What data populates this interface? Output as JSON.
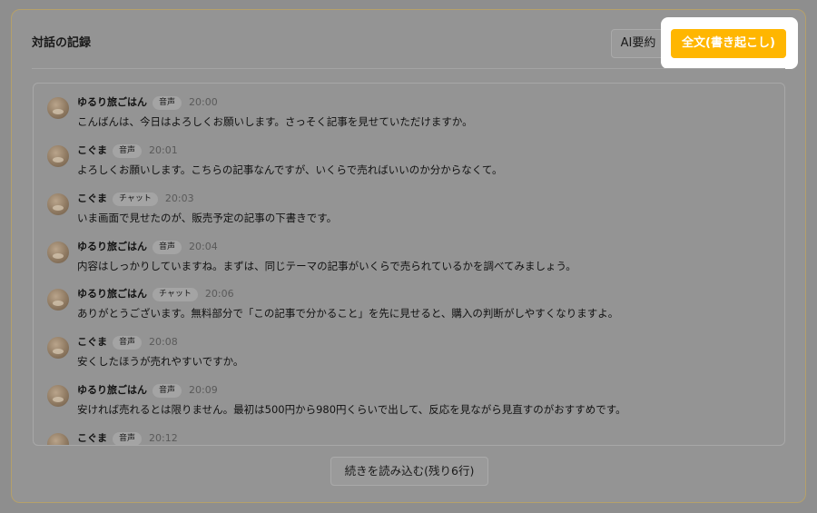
{
  "panel": {
    "title": "対話の記録",
    "summary_button": "AI要約",
    "full_text_button": "全文(書き起こし)",
    "load_more_button": "続きを読み込む(残り6行)"
  },
  "colors": {
    "accent": "#ffb600",
    "overlay": "#8e8e8e"
  },
  "messages": [
    {
      "name": "ゆるり旅ごはん",
      "channel": "音声",
      "time": "20:00",
      "text": "こんばんは、今日はよろしくお願いします。さっそく記事を見せていただけますか。"
    },
    {
      "name": "こぐま",
      "channel": "音声",
      "time": "20:01",
      "text": "よろしくお願いします。こちらの記事なんですが、いくらで売ればいいのか分からなくて。"
    },
    {
      "name": "こぐま",
      "channel": "チャット",
      "time": "20:03",
      "text": "いま画面で見せたのが、販売予定の記事の下書きです。"
    },
    {
      "name": "ゆるり旅ごはん",
      "channel": "音声",
      "time": "20:04",
      "text": "内容はしっかりしていますね。まずは、同じテーマの記事がいくらで売られているかを調べてみましょう。"
    },
    {
      "name": "ゆるり旅ごはん",
      "channel": "チャット",
      "time": "20:06",
      "text": "ありがとうございます。無料部分で「この記事で分かること」を先に見せると、購入の判断がしやすくなりますよ。"
    },
    {
      "name": "こぐま",
      "channel": "音声",
      "time": "20:08",
      "text": "安くしたほうが売れやすいですか。"
    },
    {
      "name": "ゆるり旅ごはん",
      "channel": "音声",
      "time": "20:09",
      "text": "安ければ売れるとは限りません。最初は500円から980円くらいで出して、反応を見ながら見直すのがおすすめです。"
    },
    {
      "name": "こぐま",
      "channel": "音声",
      "time": "20:12",
      "text": ""
    }
  ]
}
